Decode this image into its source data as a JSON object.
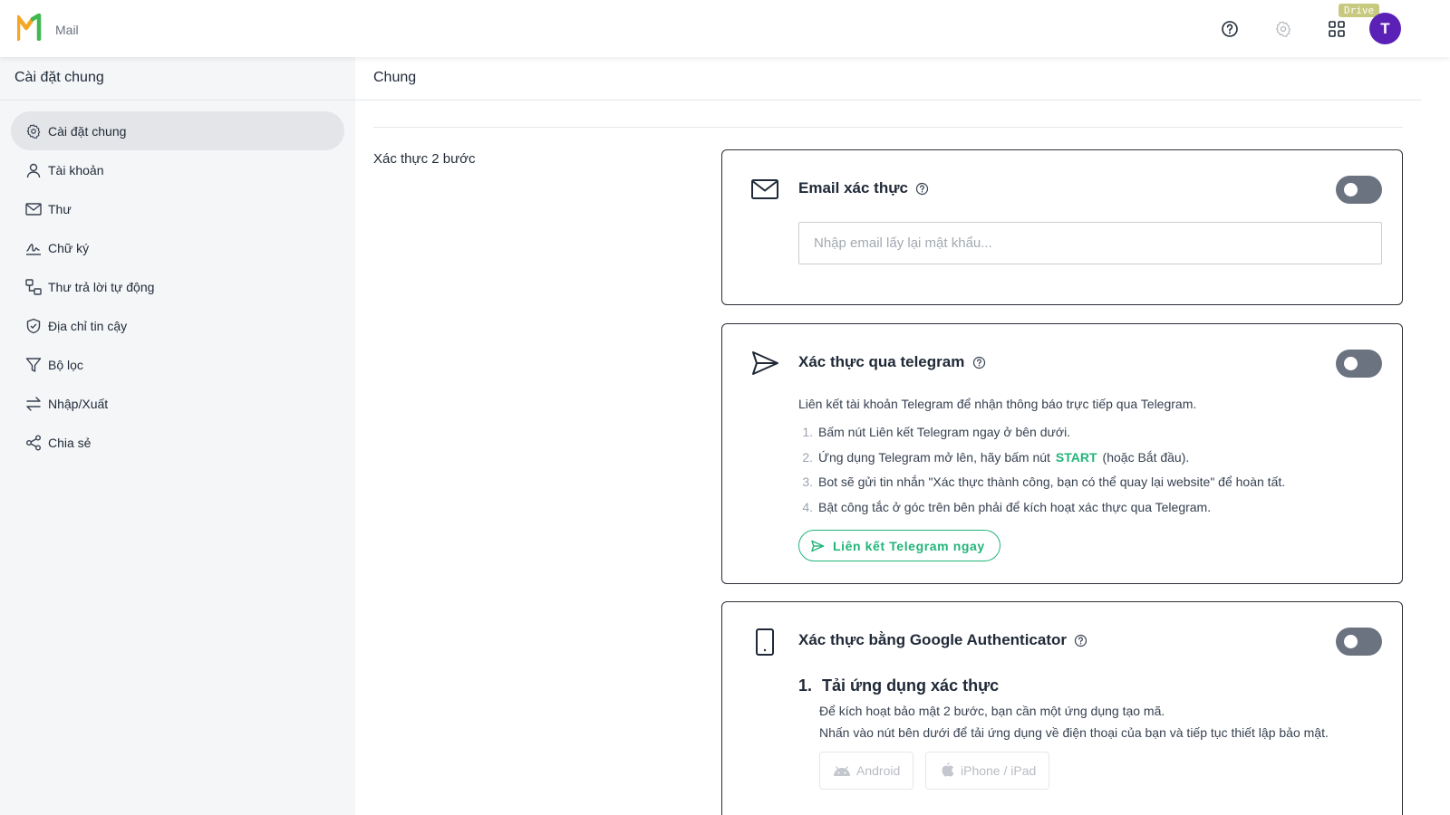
{
  "app": {
    "brand_name": "Mail",
    "drive_badge": "Drive",
    "avatar_letter": "T"
  },
  "colors": {
    "accent_green": "#22b47a",
    "logo_orange": "#f5a623",
    "logo_green": "#3fb950",
    "avatar_purple": "#5b21b6",
    "toggle_off": "#6b7280"
  },
  "topbar": {
    "icons": [
      "help-circle-icon",
      "gear-icon",
      "apps-grid-icon"
    ]
  },
  "sidebar": {
    "title": "Cài đặt chung",
    "items": [
      {
        "label": "Cài đặt chung",
        "icon": "gear-icon",
        "active": true
      },
      {
        "label": "Tài khoản",
        "icon": "user-icon",
        "active": false
      },
      {
        "label": "Thư",
        "icon": "mail-icon",
        "active": false
      },
      {
        "label": "Chữ ký",
        "icon": "signature-icon",
        "active": false
      },
      {
        "label": "Thư trả lời tự động",
        "icon": "auto-reply-icon",
        "active": false
      },
      {
        "label": "Địa chỉ tin cậy",
        "icon": "shield-check-icon",
        "active": false
      },
      {
        "label": "Bộ lọc",
        "icon": "filter-icon",
        "active": false
      },
      {
        "label": "Nhập/Xuất",
        "icon": "import-export-icon",
        "active": false
      },
      {
        "label": "Chia sẻ",
        "icon": "share-icon",
        "active": false
      }
    ]
  },
  "main": {
    "title": "Chung",
    "section_label": "Xác thực 2 bước",
    "email_card": {
      "title": "Email xác thực",
      "enabled": false,
      "input_value": "",
      "input_placeholder": "Nhập email lấy lại mật khẩu..."
    },
    "telegram_card": {
      "title": "Xác thực qua telegram",
      "enabled": false,
      "description": "Liên kết tài khoản Telegram để nhận thông báo trực tiếp qua Telegram.",
      "steps": [
        {
          "num": "1.",
          "text": "Bấm nút Liên kết Telegram ngay ở bên dưới."
        },
        {
          "num": "2.",
          "text_before": "Ứng dụng Telegram mở lên, hãy bấm nút",
          "highlight": "START",
          "text_after": "(hoặc Bắt đầu)."
        },
        {
          "num": "3.",
          "text": "Bot sẽ gửi tin nhắn \"Xác thực thành công, bạn có thể quay lại website\" để hoàn tất."
        },
        {
          "num": "4.",
          "text": "Bật công tắc ở góc trên bên phải để kích hoạt xác thực qua Telegram."
        }
      ],
      "button_label": "Liên kết Telegram ngay"
    },
    "ga_card": {
      "title": "Xác thực bằng Google Authenticator",
      "enabled": false,
      "step_num": "1.",
      "step_title": "Tải ứng dụng xác thực",
      "desc1": "Để kích hoạt bảo mật 2 bước, bạn cần một ứng dụng tạo mã.",
      "desc2": "Nhấn vào nút bên dưới để tải ứng dụng về điện thoại của bạn và tiếp tục thiết lập bảo mật.",
      "android_label": "Android",
      "ios_label": "iPhone / iPad"
    }
  }
}
